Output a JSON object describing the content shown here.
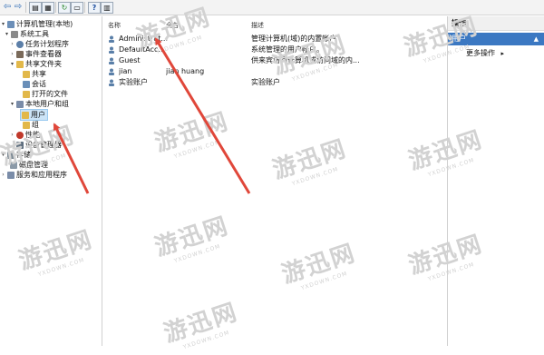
{
  "toolbar": {
    "icons": [
      "back-icon",
      "forward-icon",
      "up-icon",
      "show-hide-tree-icon",
      "refresh-icon",
      "export-icon",
      "help-icon",
      "properties-icon"
    ]
  },
  "tree": {
    "root": "计算机管理(本地)",
    "system_tools": "系统工具",
    "task_scheduler": "任务计划程序",
    "event_viewer": "事件查看器",
    "shared_folders": "共享文件夹",
    "shares": "共享",
    "sessions": "会话",
    "open_files": "打开的文件",
    "local_users_groups": "本地用户和组",
    "users": "用户",
    "groups": "组",
    "performance": "性能",
    "device_manager": "设备管理器",
    "storage": "存储",
    "disk_management": "磁盘管理",
    "services_apps": "服务和应用程序"
  },
  "list": {
    "columns": [
      "名称",
      "全名",
      "描述"
    ],
    "rows": [
      {
        "name": "Administrat...",
        "fullname": "",
        "desc": "管理计算机(域)的内置帐户"
      },
      {
        "name": "DefaultAcc...",
        "fullname": "",
        "desc": "系统管理的用户帐户。"
      },
      {
        "name": "Guest",
        "fullname": "",
        "desc": "供来宾访问计算机或访问域的内..."
      },
      {
        "name": "jian",
        "fullname": "jian huang",
        "desc": ""
      },
      {
        "name": "实验账户",
        "fullname": "",
        "desc": "实验账户"
      }
    ]
  },
  "actions": {
    "title": "操作",
    "section": "用户",
    "more": "更多操作"
  },
  "watermark": {
    "text": "游迅网",
    "sub": "YXDOWN.COM"
  },
  "colors": {
    "selection": "#cce4f7",
    "arrow": "#e0473a",
    "action_header": "#3b78c2"
  }
}
